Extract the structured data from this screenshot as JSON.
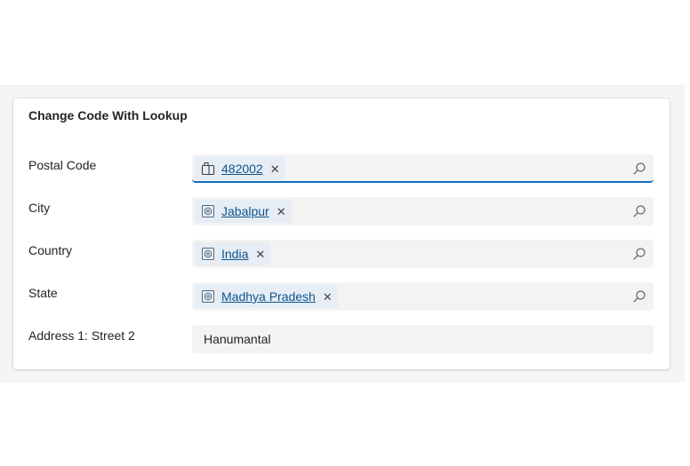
{
  "card": {
    "title": "Change Code With Lookup",
    "fields": [
      {
        "label": "Postal Code",
        "value": "482002",
        "icon": "postal-code-icon",
        "focused": true
      },
      {
        "label": "City",
        "value": "Jabalpur",
        "icon": "entity-icon"
      },
      {
        "label": "Country",
        "value": "India",
        "icon": "entity-icon"
      },
      {
        "label": "State",
        "value": "Madhya Pradesh",
        "icon": "entity-icon"
      }
    ],
    "street": {
      "label": "Address 1: Street 2",
      "value": "Hanumantal"
    }
  },
  "colors": {
    "accent": "#0f6cbd",
    "link": "#0f548c",
    "tag_bg": "#e6edf5",
    "field_bg": "#f3f3f3"
  }
}
